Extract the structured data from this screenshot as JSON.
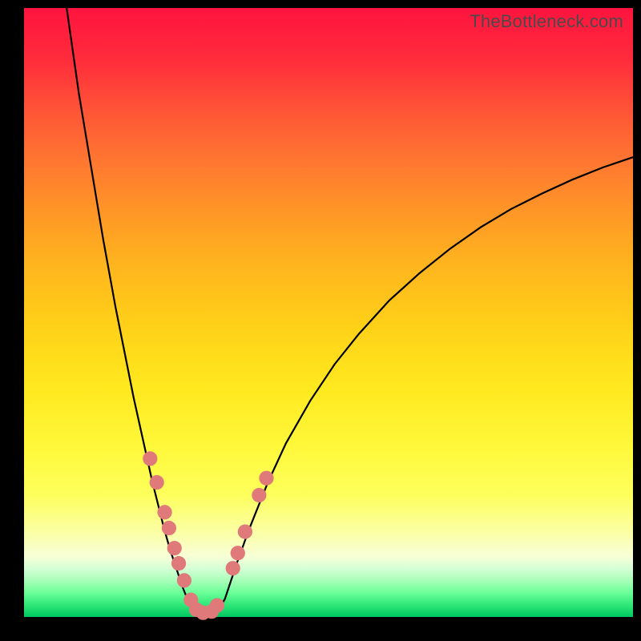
{
  "watermark": "TheBottleneck.com",
  "chart_data": {
    "type": "line",
    "title": "",
    "xlabel": "",
    "ylabel": "",
    "xlim": [
      0,
      100
    ],
    "ylim": [
      0,
      100
    ],
    "grid": false,
    "legend": false,
    "series": [
      {
        "name": "left-branch",
        "x": [
          7,
          8,
          9,
          10,
          11,
          12,
          13,
          14,
          15,
          16,
          17,
          18,
          19,
          20,
          21,
          22,
          23,
          24,
          25,
          26,
          27,
          27.5
        ],
        "y": [
          100,
          93,
          86,
          80,
          74,
          68,
          62,
          56.5,
          51,
          46,
          41,
          36,
          31.5,
          27,
          22.5,
          18.5,
          14.5,
          11,
          8,
          5,
          2.5,
          1.2
        ]
      },
      {
        "name": "valley-floor",
        "x": [
          27.5,
          28,
          29,
          30,
          31,
          32
        ],
        "y": [
          1.2,
          0.6,
          0.4,
          0.4,
          0.6,
          1.2
        ]
      },
      {
        "name": "right-branch",
        "x": [
          32,
          33,
          34,
          35,
          37,
          40,
          43,
          47,
          51,
          55,
          60,
          65,
          70,
          75,
          80,
          85,
          90,
          95,
          100
        ],
        "y": [
          1.2,
          3,
          6,
          9,
          14.5,
          22,
          28.5,
          35.5,
          41.5,
          46.5,
          52,
          56.5,
          60.5,
          64,
          67,
          69.5,
          71.8,
          73.8,
          75.5
        ]
      }
    ],
    "markers": [
      {
        "name": "left-cluster",
        "points": [
          {
            "x": 20.7,
            "y": 26.0
          },
          {
            "x": 21.8,
            "y": 22.1
          },
          {
            "x": 23.1,
            "y": 17.2
          },
          {
            "x": 23.8,
            "y": 14.6
          },
          {
            "x": 24.7,
            "y": 11.3
          },
          {
            "x": 25.4,
            "y": 8.8
          },
          {
            "x": 26.3,
            "y": 6.0
          },
          {
            "x": 27.4,
            "y": 2.8
          },
          {
            "x": 28.3,
            "y": 1.2
          },
          {
            "x": 29.4,
            "y": 0.7
          },
          {
            "x": 30.8,
            "y": 0.9
          },
          {
            "x": 31.7,
            "y": 1.9
          }
        ]
      },
      {
        "name": "right-cluster",
        "points": [
          {
            "x": 34.3,
            "y": 8.0
          },
          {
            "x": 35.1,
            "y": 10.5
          },
          {
            "x": 36.3,
            "y": 14.0
          },
          {
            "x": 38.6,
            "y": 20.0
          },
          {
            "x": 39.8,
            "y": 22.8
          }
        ]
      }
    ],
    "marker_radius": 1.2,
    "marker_color": "#e07a7a",
    "line_color": "#000000"
  }
}
